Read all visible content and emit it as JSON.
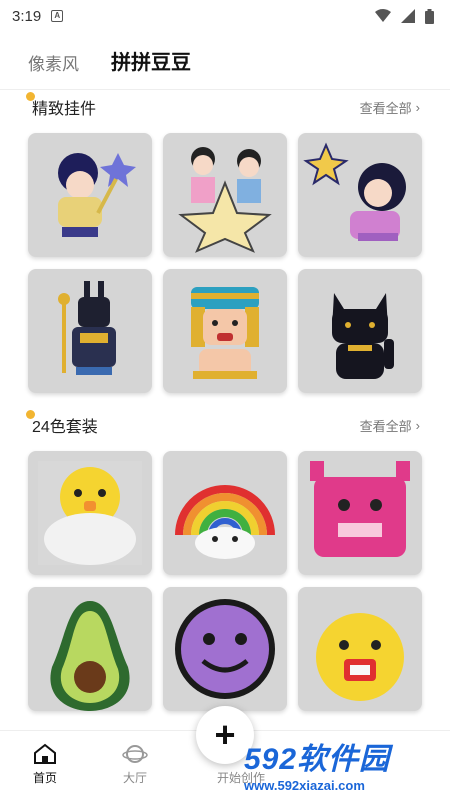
{
  "status": {
    "time": "3:19"
  },
  "tabs": [
    {
      "label": "像素风"
    },
    {
      "label": "拼拼豆豆"
    }
  ],
  "sections": [
    {
      "title": "精致挂件",
      "see_all": "查看全部"
    },
    {
      "title": "24色套装",
      "see_all": "查看全部"
    }
  ],
  "nav": [
    {
      "label": "首页"
    },
    {
      "label": "大厅"
    },
    {
      "label": "开始创作"
    }
  ],
  "fab": {
    "symbol": "+"
  },
  "watermark": {
    "brand": "592软件园",
    "url": "www.592xiazai.com"
  },
  "colors": {
    "accent": "#bfe86b",
    "dot": "#f2b531",
    "card_bg": "#d5d5d5",
    "watermark": "#1a66d8"
  }
}
